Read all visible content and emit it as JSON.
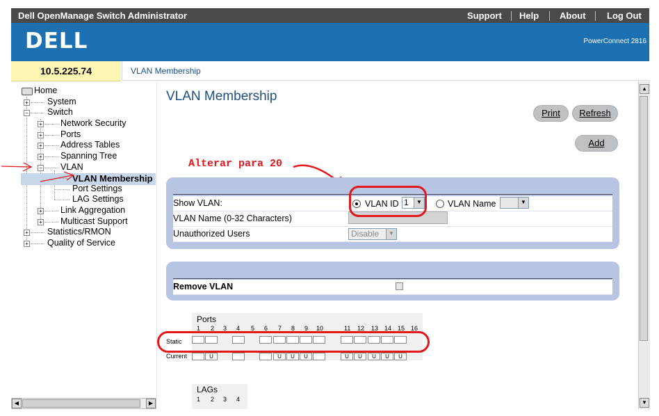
{
  "header": {
    "app_title": "Dell OpenManage Switch Administrator",
    "links": [
      "Support",
      "Help",
      "About",
      "Log Out"
    ]
  },
  "banner": {
    "logo_text": "DELL",
    "product": "PowerConnect 2816"
  },
  "info": {
    "ip": "10.5.225.74",
    "breadcrumb": "VLAN Membership"
  },
  "tree": {
    "items": [
      {
        "label": "Home"
      },
      {
        "label": "System"
      },
      {
        "label": "Switch"
      },
      {
        "label": "Network Security"
      },
      {
        "label": "Ports"
      },
      {
        "label": "Address Tables"
      },
      {
        "label": "Spanning Tree"
      },
      {
        "label": "VLAN"
      },
      {
        "label": "VLAN Membership"
      },
      {
        "label": "Port Settings"
      },
      {
        "label": "LAG Settings"
      },
      {
        "label": "Link Aggregation"
      },
      {
        "label": "Multicast Support"
      },
      {
        "label": "Statistics/RMON"
      },
      {
        "label": "Quality of Service"
      }
    ]
  },
  "main": {
    "title": "VLAN Membership",
    "buttons": {
      "print": "Print",
      "refresh": "Refresh",
      "add": "Add"
    },
    "annotation": "Alterar para 20",
    "show_vlan": {
      "label": "Show VLAN:",
      "vlan_id_label": "VLAN ID",
      "vlan_id_value": "1",
      "vlan_name_label": "VLAN Name",
      "selected": "VLAN ID"
    },
    "vlan_name_label": "VLAN Name (0-32 Characters)",
    "unauth_label": "Unauthorized Users",
    "unauth_value": "Disable",
    "remove_vlan_label": "Remove VLAN",
    "ports": {
      "title": "Ports",
      "numbers": [
        "1",
        "2",
        "3",
        "4",
        "5",
        "6",
        "7",
        "8",
        "9",
        "10",
        "11",
        "12",
        "13",
        "14",
        "15",
        "16"
      ],
      "static_label": "Static",
      "current_label": "Current",
      "current_values": [
        "",
        "U",
        "",
        "",
        "",
        "",
        "U",
        "U",
        "U",
        "",
        "",
        "U",
        "U",
        "U",
        "U",
        "U"
      ]
    },
    "lags": {
      "title": "LAGs",
      "numbers": [
        "1",
        "2",
        "3",
        "4"
      ]
    }
  },
  "colors": {
    "banner": "#1c6fb0",
    "panel": "#b8c5e2",
    "title": "#1d4f84",
    "annotation": "#e2161b",
    "ip_bg": "#fff6b3"
  }
}
